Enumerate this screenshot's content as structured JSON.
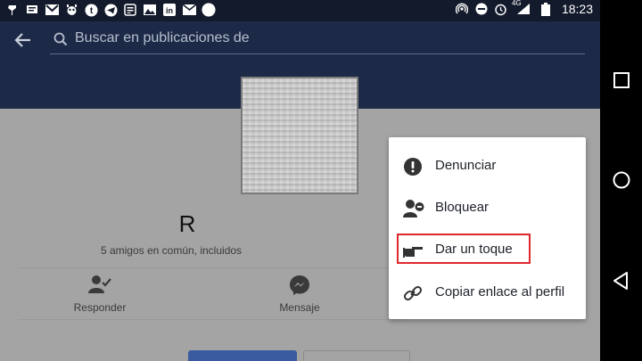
{
  "status_bar": {
    "time": "18:23",
    "network": "4G",
    "left_icons": [
      "pin-icon",
      "message-icon",
      "gmail-icon",
      "bug-icon",
      "tumblr-icon",
      "telegram-icon",
      "news-icon",
      "image-icon",
      "linkedin-icon",
      "mail-icon",
      "circle-icon"
    ],
    "right_icons": [
      "hotspot-icon",
      "dnd-icon",
      "alarm-icon",
      "signal-icon",
      "battery-icon"
    ]
  },
  "header": {
    "search": {
      "placeholder": "Buscar en publicaciones de"
    }
  },
  "profile": {
    "name": "R",
    "mutual_friends": "5 amigos en común, incluidos",
    "actions": [
      {
        "label": "Responder",
        "icon": "add-friend-icon"
      },
      {
        "label": "Mensaje",
        "icon": "messenger-icon"
      }
    ]
  },
  "menu": {
    "items": [
      {
        "label": "Denunciar",
        "icon": "report-icon"
      },
      {
        "label": "Bloquear",
        "icon": "block-user-icon"
      },
      {
        "label": "Dar un toque",
        "icon": "poke-icon",
        "highlighted": true
      },
      {
        "label": "Copiar enlace al perfil",
        "icon": "link-icon"
      }
    ]
  },
  "colors": {
    "header_bg": "#1d2a47",
    "status_bg": "#131a2b",
    "dim_overlay": "#a4a4a4",
    "highlight": "#e0272e",
    "accent": "#3b5ba0"
  }
}
